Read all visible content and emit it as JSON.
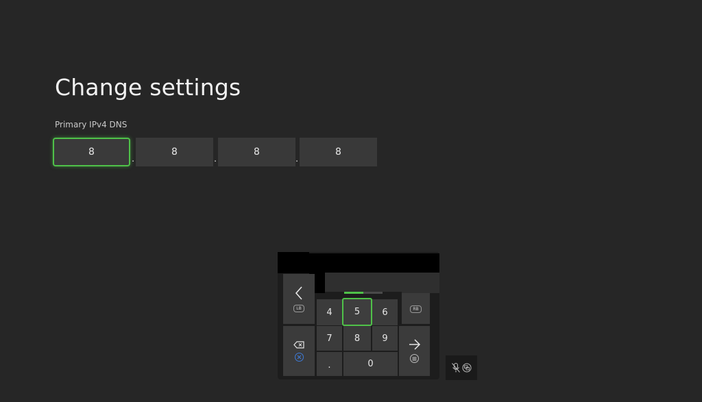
{
  "page": {
    "title": "Change settings",
    "field_label": "Primary IPv4 DNS",
    "octets": [
      "8",
      "8",
      "8",
      "8"
    ],
    "separators": [
      ".",
      ".",
      "."
    ],
    "focused_octet": 0
  },
  "keypad": {
    "keys": {
      "k4": "4",
      "k5": "5",
      "k6": "6",
      "k7": "7",
      "k8": "8",
      "k9": "9",
      "dot": ".",
      "k0": "0"
    },
    "selected_key": "5",
    "entry_progress": 0.5,
    "left_badge": "LB",
    "right_badge": "RB",
    "icons": {
      "prev": "chevron-left-icon",
      "next": "chevron-right-icon",
      "backspace": "backspace-icon",
      "enter": "arrow-right-icon",
      "x_button": "x-button-icon",
      "menu_button": "menu-button-icon",
      "mic": "mic-off-icon",
      "view": "view-button-icon"
    }
  },
  "colors": {
    "accent": "#4fc249",
    "background": "#262626",
    "field": "#393939",
    "key": "#3b3b3b",
    "x_button": "#3d7bd9"
  }
}
